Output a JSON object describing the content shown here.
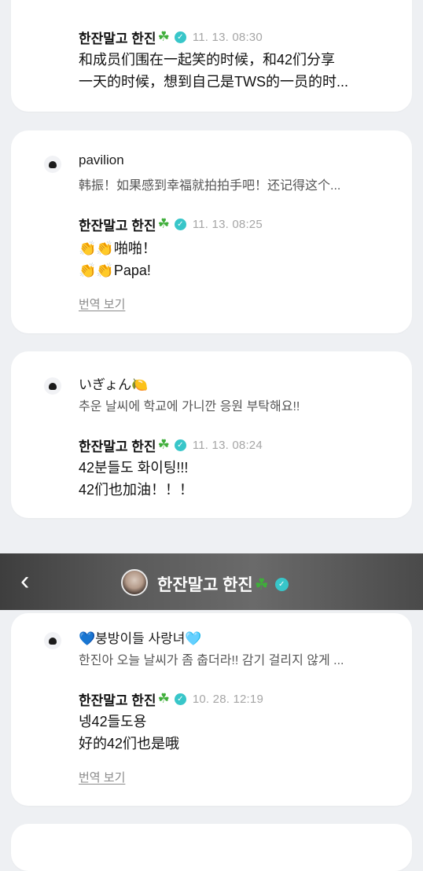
{
  "cards": [
    {
      "artist": "한잔말고 한진",
      "time": "11. 13. 08:30",
      "reply_lines": [
        "和成员们围在一起笑的时候，和42们分享",
        "一天的时候，想到自己是TWS的一员的时..."
      ]
    },
    {
      "fan_name": "pavilion",
      "fan_msg": "韩振！如果感到幸福就拍拍手吧！还记得这个...",
      "artist": "한잔말고 한진",
      "time": "11. 13. 08:25",
      "reply_lines": [
        "啪啪！",
        "Papa!"
      ],
      "translate": "번역 보기"
    },
    {
      "fan_name": "いぎょん",
      "fan_msg": "추운 날씨에 학교에 가니깐 응원 부탁해요!!",
      "artist": "한잔말고 한진",
      "time": "11. 13. 08:24",
      "reply_lines": [
        "42분들도 화이팅!!!",
        "42们也加油！！！"
      ]
    },
    {
      "fan_name": "붕방이들 사랑녀",
      "fan_msg": "한진아 오늘 날씨가 좀 춥더라!! 감기 걸리지 않게 ...",
      "artist": "한잔말고 한진",
      "time": "10. 28. 12:19",
      "reply_lines": [
        "넹42들도용",
        "好的42们也是哦"
      ],
      "translate": "번역 보기"
    }
  ],
  "header": {
    "title": "한잔말고 한진",
    "back_icon": "chevron-left-icon"
  },
  "colors": {
    "background": "#eef0f3",
    "card": "#ffffff",
    "verified": "#38c6c9",
    "clover": "#3fae3a",
    "timestamp": "#a6a6a6"
  }
}
